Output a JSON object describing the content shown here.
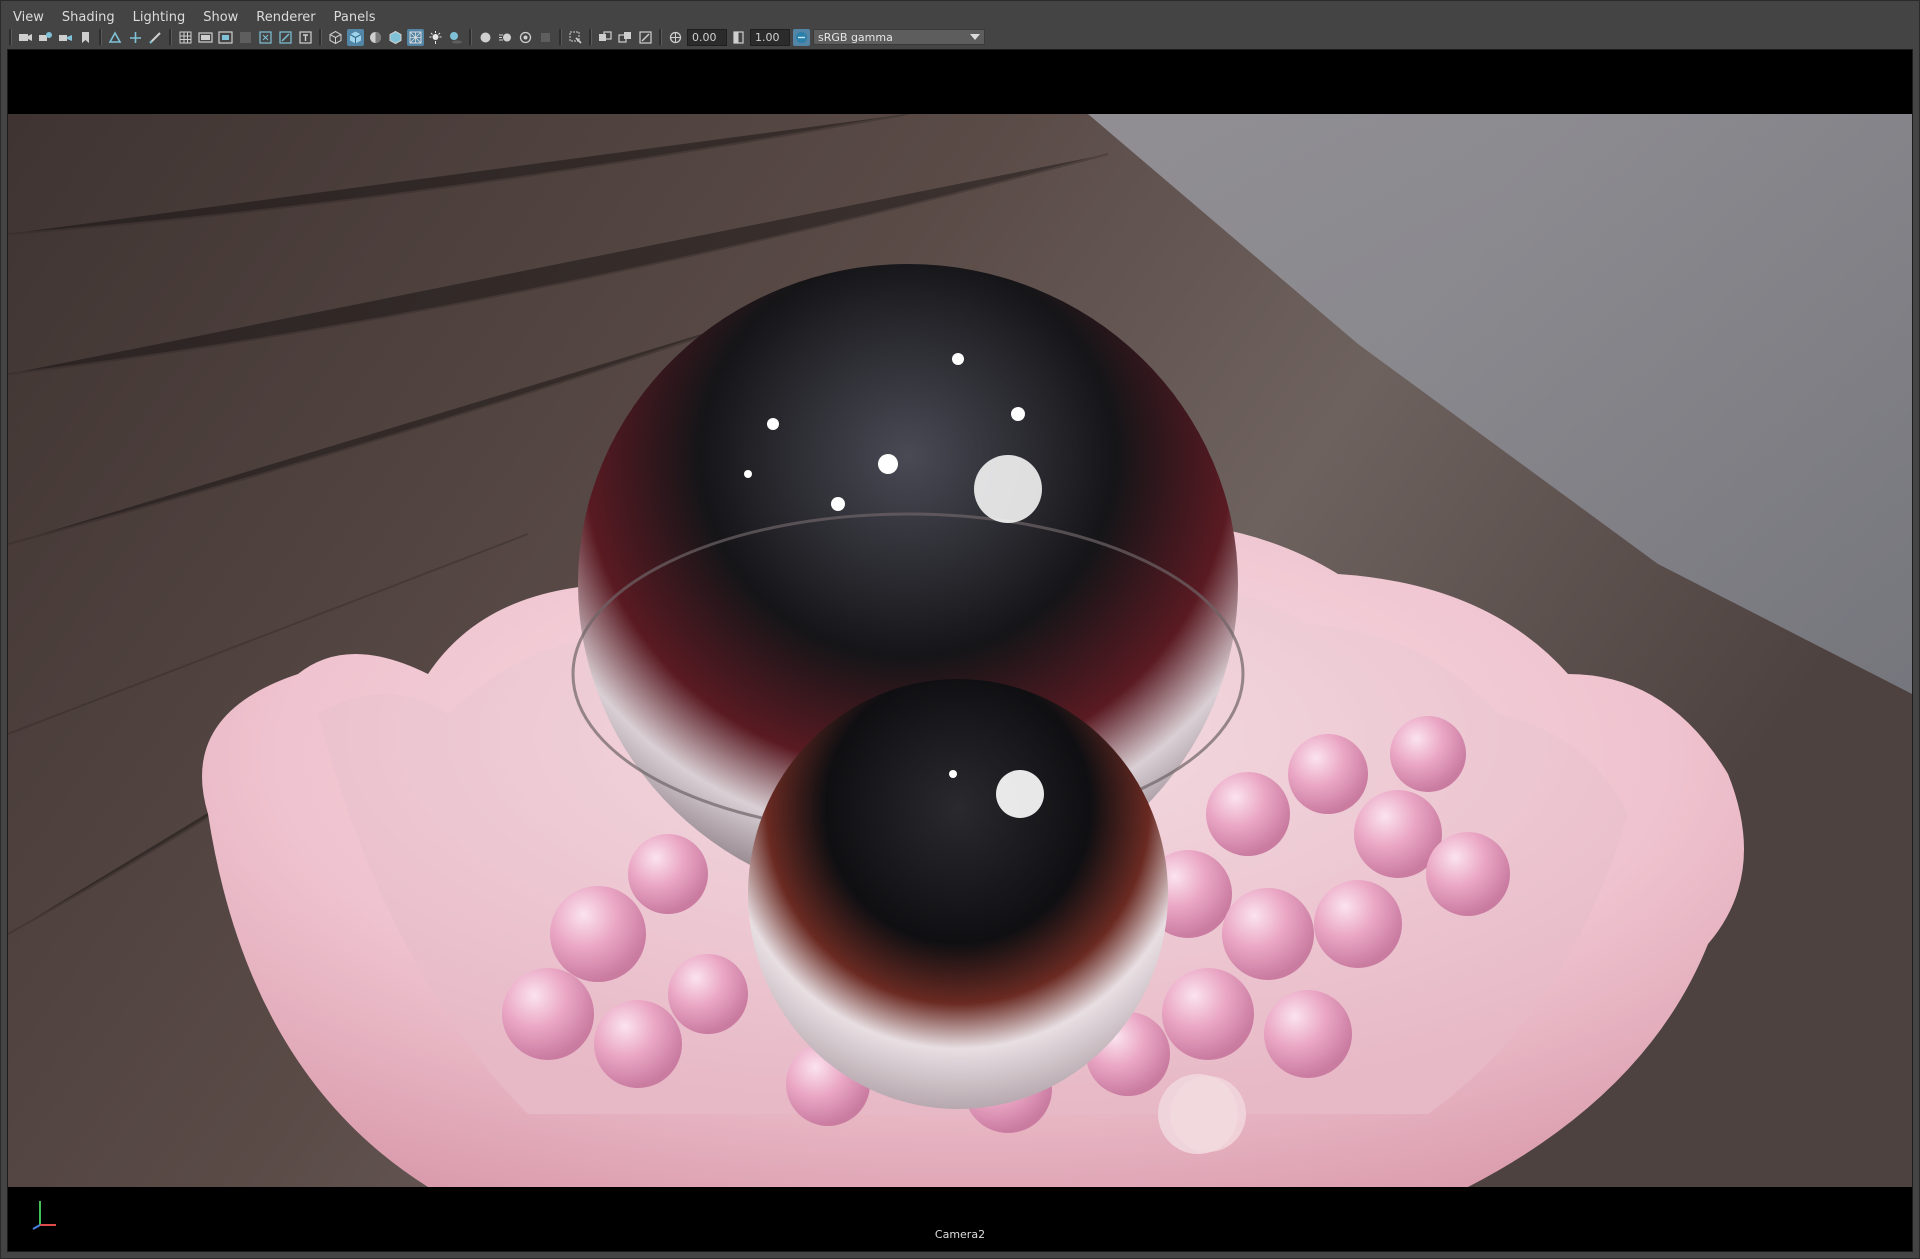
{
  "menu": [
    "View",
    "Shading",
    "Lighting",
    "Show",
    "Renderer",
    "Panels"
  ],
  "toolbar": {
    "exposure_value": "0.00",
    "gamma_value": "1.00",
    "colorspace": "sRGB gamma"
  },
  "viewport": {
    "camera_label": "Camera2"
  },
  "icons": [
    "camera-icon",
    "camera-attributes-icon",
    "bookmark-camera-icon",
    "image-plane-icon",
    "2d-pan-icon",
    "grease-pencil-icon",
    "grid-icon",
    "film-gate-icon",
    "resolution-gate-icon",
    "gate-mask-icon",
    "field-chart-icon",
    "safe-action-icon",
    "safe-title-icon",
    "wireframe-icon",
    "smooth-shade-icon",
    "default-material-icon",
    "wireframe-on-shaded-icon",
    "xray-icon",
    "use-all-lights-icon",
    "shadows-icon",
    "screen-space-ao-icon",
    "motion-blur-icon",
    "multisample-aa-icon",
    "depth-of-field-icon",
    "isolate-select-icon",
    "xray-joints-icon",
    "xray-active-icon",
    "exposure-icon",
    "gamma-icon",
    "color-management-icon"
  ],
  "colors": {
    "panel": "#444444",
    "active": "#5285a6",
    "bowl": "#f2c6d0",
    "pearl": "#e9a6c3"
  }
}
